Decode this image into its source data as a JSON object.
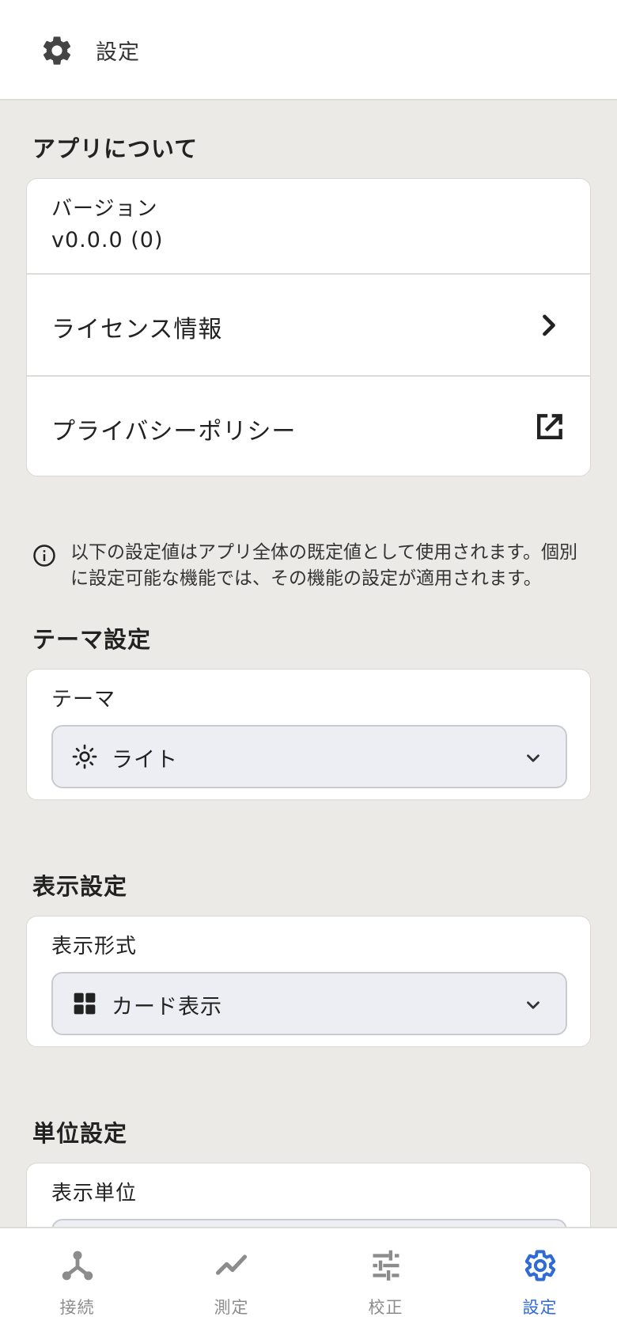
{
  "header": {
    "title": "設定",
    "icon": "gear-icon"
  },
  "about": {
    "section_title": "アプリについて",
    "version_label": "バージョン",
    "version_value": "v0.0.0 (0)",
    "license_label": "ライセンス情報",
    "privacy_label": "プライバシーポリシー"
  },
  "info_text": "以下の設定値はアプリ全体の既定値として使用されます。個別に設定可能な機能では、その機能の設定が適用されます。",
  "theme": {
    "section_title": "テーマ設定",
    "field_label": "テーマ",
    "selected": "ライト",
    "selected_icon": "sun-icon"
  },
  "display": {
    "section_title": "表示設定",
    "field_label": "表示形式",
    "selected": "カード表示",
    "selected_icon": "grid-icon"
  },
  "units": {
    "section_title": "単位設定",
    "field_label": "表示単位"
  },
  "bottom_nav": {
    "items": [
      {
        "label": "接続",
        "icon": "connection-icon",
        "active": false
      },
      {
        "label": "測定",
        "icon": "trend-icon",
        "active": false
      },
      {
        "label": "校正",
        "icon": "tune-icon",
        "active": false
      },
      {
        "label": "設定",
        "icon": "gear-icon",
        "active": true
      }
    ]
  },
  "colors": {
    "background": "#ebeae6",
    "card": "#ffffff",
    "accent": "#2f6bd3",
    "inactive": "#8c8c8c",
    "select_fill": "#eceef3"
  }
}
